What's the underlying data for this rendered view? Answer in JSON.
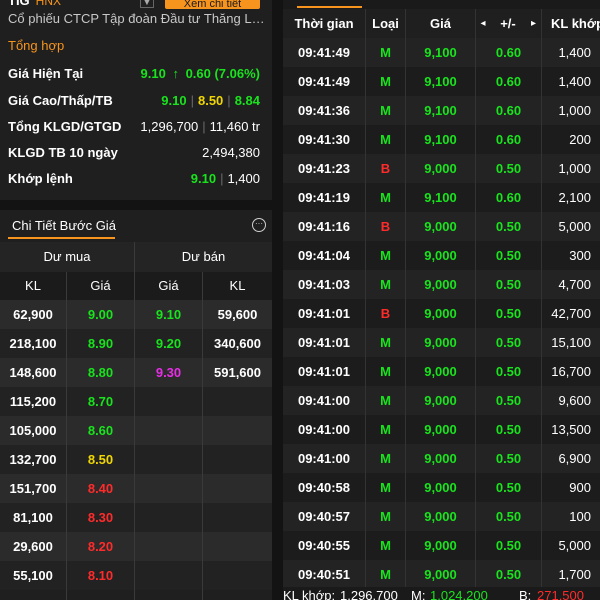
{
  "header": {
    "symbol": "TIG",
    "exchange": "HNX",
    "mini_button": "▼",
    "detail_button": "Xem chi tiết",
    "company": "Cổ phiếu CTCP Tập đoàn Đầu tư Thăng Long"
  },
  "summary": {
    "title": "Tổng hợp",
    "current_price": {
      "label": "Giá Hiện Tại",
      "price": "9.10",
      "arrow": "↑",
      "change": "0.60 (7.06%)"
    },
    "high_low_ref": {
      "label": "Giá Cao/Thấp/TB",
      "high": "9.10",
      "low": "8.50",
      "avg": "8.84"
    },
    "total_volume": {
      "label": "Tổng KLGD/GTGD",
      "volume": "1,296,700",
      "value": "11,460 tr"
    },
    "avg10": {
      "label": "KLGD TB 10 ngày",
      "value": "2,494,380"
    },
    "matched": {
      "label": "Khớp lệnh",
      "price": "9.10",
      "volume": "1,400"
    }
  },
  "order_book": {
    "tab_label": "Chi Tiết Bước Giá",
    "menu_icon": "···",
    "bid_group": "Dư mua",
    "ask_group": "Dư bán",
    "columns": [
      "KL",
      "Giá",
      "Giá",
      "KL"
    ],
    "rows": [
      {
        "bid_vol": "62,900",
        "bid_price": "9.00",
        "bid_color": "green",
        "ask_price": "9.10",
        "ask_color": "green",
        "ask_vol": "59,600"
      },
      {
        "bid_vol": "218,100",
        "bid_price": "8.90",
        "bid_color": "green",
        "ask_price": "9.20",
        "ask_color": "green",
        "ask_vol": "340,600"
      },
      {
        "bid_vol": "148,600",
        "bid_price": "8.80",
        "bid_color": "green",
        "ask_price": "9.30",
        "ask_color": "purple",
        "ask_vol": "591,600"
      },
      {
        "bid_vol": "115,200",
        "bid_price": "8.70",
        "bid_color": "green",
        "ask_price": "",
        "ask_color": "white",
        "ask_vol": ""
      },
      {
        "bid_vol": "105,000",
        "bid_price": "8.60",
        "bid_color": "green",
        "ask_price": "",
        "ask_color": "white",
        "ask_vol": ""
      },
      {
        "bid_vol": "132,700",
        "bid_price": "8.50",
        "bid_color": "yellow",
        "ask_price": "",
        "ask_color": "white",
        "ask_vol": ""
      },
      {
        "bid_vol": "151,700",
        "bid_price": "8.40",
        "bid_color": "red",
        "ask_price": "",
        "ask_color": "white",
        "ask_vol": ""
      },
      {
        "bid_vol": "81,100",
        "bid_price": "8.30",
        "bid_color": "red",
        "ask_price": "",
        "ask_color": "white",
        "ask_vol": ""
      },
      {
        "bid_vol": "29,600",
        "bid_price": "8.20",
        "bid_color": "red",
        "ask_price": "",
        "ask_color": "white",
        "ask_vol": ""
      },
      {
        "bid_vol": "55,100",
        "bid_price": "8.10",
        "bid_color": "red",
        "ask_price": "",
        "ask_color": "white",
        "ask_vol": ""
      }
    ]
  },
  "trades": {
    "columns": {
      "time": "Thời gian",
      "type": "Loại",
      "price": "Giá",
      "prev_icon": "◂",
      "change": "+/-",
      "next_icon": "▸",
      "volume": "KL khớp"
    },
    "rows": [
      {
        "time": "09:41:49",
        "type": "M",
        "price": "9,100",
        "change": "0.60",
        "volume": "1,400"
      },
      {
        "time": "09:41:49",
        "type": "M",
        "price": "9,100",
        "change": "0.60",
        "volume": "1,400"
      },
      {
        "time": "09:41:36",
        "type": "M",
        "price": "9,100",
        "change": "0.60",
        "volume": "1,000"
      },
      {
        "time": "09:41:30",
        "type": "M",
        "price": "9,100",
        "change": "0.60",
        "volume": "200"
      },
      {
        "time": "09:41:23",
        "type": "B",
        "price": "9,000",
        "change": "0.50",
        "volume": "1,000"
      },
      {
        "time": "09:41:19",
        "type": "M",
        "price": "9,100",
        "change": "0.60",
        "volume": "2,100"
      },
      {
        "time": "09:41:16",
        "type": "B",
        "price": "9,000",
        "change": "0.50",
        "volume": "5,000"
      },
      {
        "time": "09:41:04",
        "type": "M",
        "price": "9,000",
        "change": "0.50",
        "volume": "300"
      },
      {
        "time": "09:41:03",
        "type": "M",
        "price": "9,000",
        "change": "0.50",
        "volume": "4,700"
      },
      {
        "time": "09:41:01",
        "type": "B",
        "price": "9,000",
        "change": "0.50",
        "volume": "42,700"
      },
      {
        "time": "09:41:01",
        "type": "M",
        "price": "9,000",
        "change": "0.50",
        "volume": "15,100"
      },
      {
        "time": "09:41:01",
        "type": "M",
        "price": "9,000",
        "change": "0.50",
        "volume": "16,700"
      },
      {
        "time": "09:41:00",
        "type": "M",
        "price": "9,000",
        "change": "0.50",
        "volume": "9,600"
      },
      {
        "time": "09:41:00",
        "type": "M",
        "price": "9,000",
        "change": "0.50",
        "volume": "13,500"
      },
      {
        "time": "09:41:00",
        "type": "M",
        "price": "9,000",
        "change": "0.50",
        "volume": "6,900"
      },
      {
        "time": "09:40:58",
        "type": "M",
        "price": "9,000",
        "change": "0.50",
        "volume": "900"
      },
      {
        "time": "09:40:57",
        "type": "M",
        "price": "9,000",
        "change": "0.50",
        "volume": "100"
      },
      {
        "time": "09:40:55",
        "type": "M",
        "price": "9,000",
        "change": "0.50",
        "volume": "5,000"
      },
      {
        "time": "09:40:51",
        "type": "M",
        "price": "9,000",
        "change": "0.50",
        "volume": "1,700"
      }
    ],
    "footer": {
      "matched_label": "KL khớp:",
      "matched_value": "1,296,700",
      "buy_label": "M:",
      "buy_value": "1,024,200",
      "sell_label": "B:",
      "sell_value": "271,500"
    }
  },
  "colors": {
    "accent": "#f7941d",
    "up": "#19e31d",
    "down": "#ff2b2b",
    "reference": "#f0d700",
    "ceiling": "#e62ee6"
  }
}
